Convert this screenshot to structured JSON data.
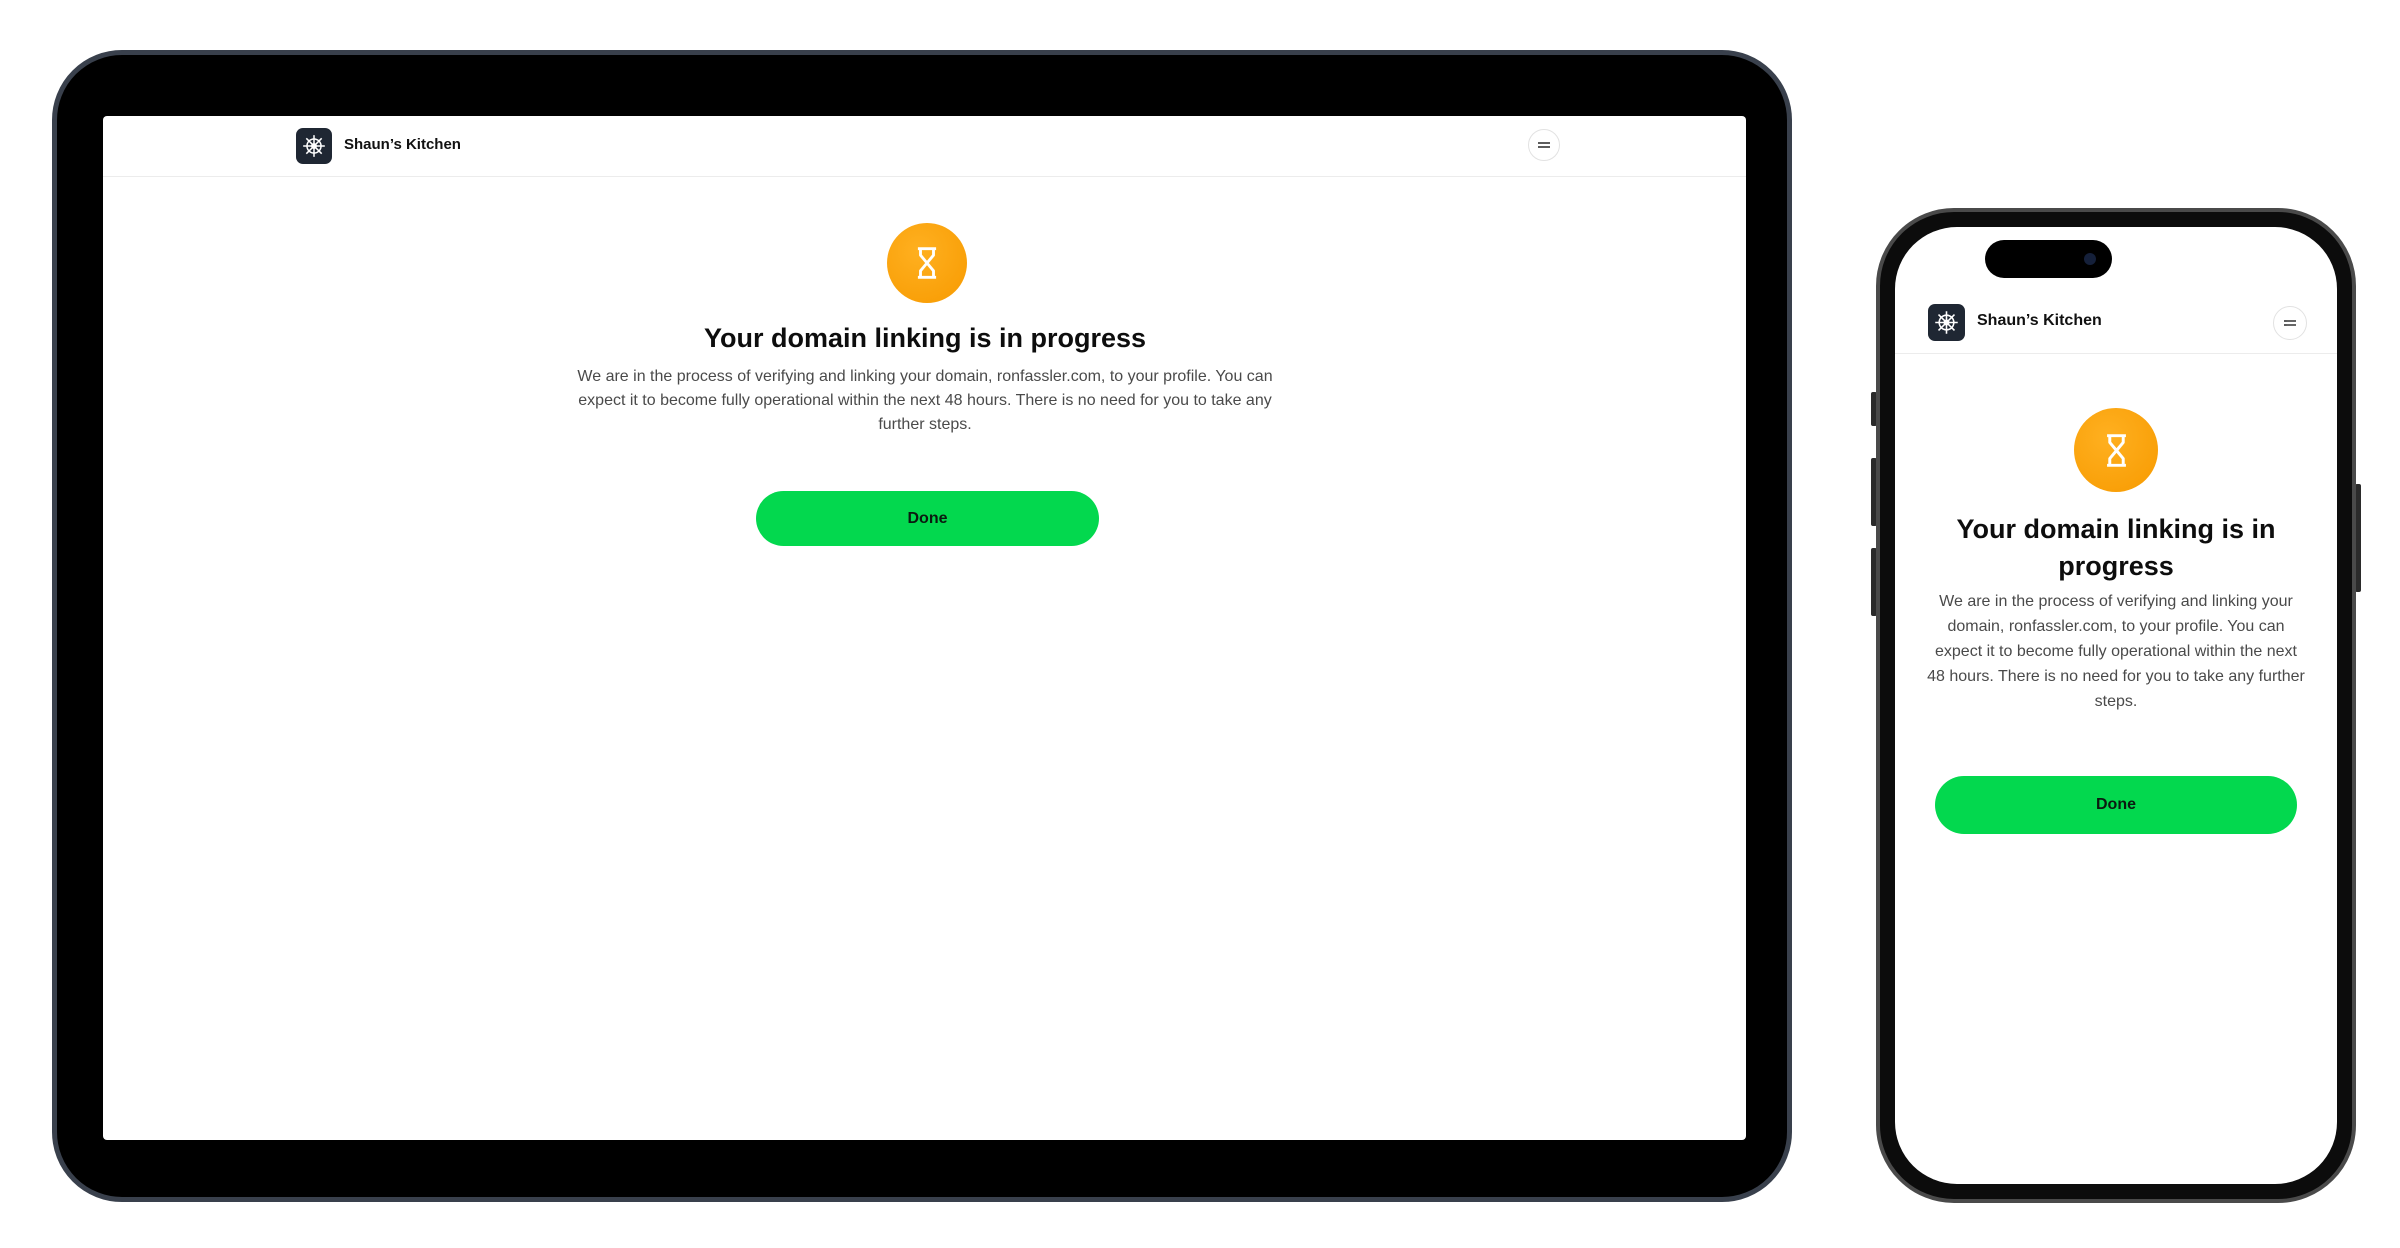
{
  "brand": {
    "name": "Shaun’s Kitchen",
    "logo_icon": "ship-wheel-icon"
  },
  "header": {
    "menu_icon": "menu-icon"
  },
  "status": {
    "icon": "hourglass-icon",
    "title": "Your domain linking is in progress",
    "description": "We are in the process of verifying and linking your domain, ronfassler.com, to your profile. You can expect it to become fully operational within the next 48 hours. There is no need for you to take any further steps."
  },
  "actions": {
    "done_label": "Done"
  },
  "colors": {
    "accent_green": "#03d84e",
    "status_orange": "#f79a00",
    "logo_bg": "#1f2733",
    "device_frame": "#39404c"
  }
}
